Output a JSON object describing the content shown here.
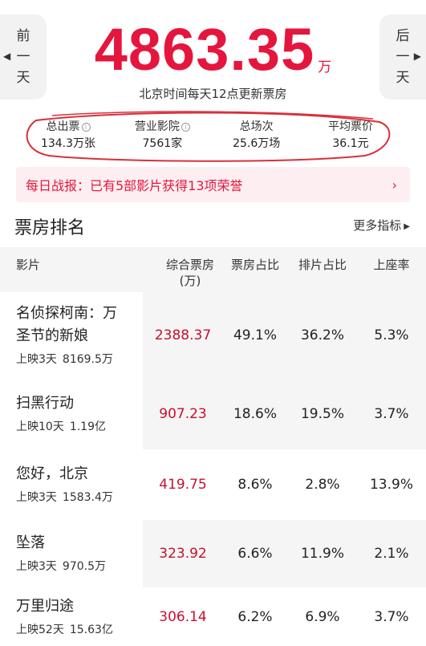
{
  "header": {
    "prev_day": [
      "前",
      "一",
      "天"
    ],
    "next_day": [
      "后",
      "一",
      "天"
    ],
    "total_box_office": "4863.35",
    "total_unit": "万",
    "update_note": "北京时间每天12点更新票房"
  },
  "stats": [
    {
      "label": "总出票",
      "value": "134.3万张",
      "has_info": true
    },
    {
      "label": "营业影院",
      "value": "7561家",
      "has_info": true
    },
    {
      "label": "总场次",
      "value": "25.6万场",
      "has_info": false
    },
    {
      "label": "平均票价",
      "value": "36.1元",
      "has_info": false
    }
  ],
  "banner": {
    "text": "每日战报：已有5部影片获得13项荣誉",
    "chevron": "›"
  },
  "ranking": {
    "title": "票房排名",
    "more": "更多指标",
    "columns": {
      "film": "影片",
      "gross_line1": "综合票房",
      "gross_line2": "(万)",
      "share": "票房占比",
      "schedule": "排片占比",
      "occupancy": "上座率"
    },
    "rows": [
      {
        "name_line1": "名侦探柯南：万",
        "name_line2": "圣节的新娘",
        "days": "上映3天",
        "cumulative": "8169.5万",
        "gross": "2388.37",
        "share": "49.1%",
        "schedule": "36.2%",
        "occupancy": "5.3%"
      },
      {
        "name_line1": "扫黑行动",
        "name_line2": "",
        "days": "上映10天",
        "cumulative": "1.19亿",
        "gross": "907.23",
        "share": "18.6%",
        "schedule": "19.5%",
        "occupancy": "3.7%"
      },
      {
        "name_line1": "您好，北京",
        "name_line2": "",
        "days": "上映3天",
        "cumulative": "1583.4万",
        "gross": "419.75",
        "share": "8.6%",
        "schedule": "2.8%",
        "occupancy": "13.9%"
      },
      {
        "name_line1": "坠落",
        "name_line2": "",
        "days": "上映3天",
        "cumulative": "970.5万",
        "gross": "323.92",
        "share": "6.6%",
        "schedule": "11.9%",
        "occupancy": "2.1%"
      },
      {
        "name_line1": "万里归途",
        "name_line2": "",
        "days": "上映52天",
        "cumulative": "15.63亿",
        "gross": "306.14",
        "share": "6.2%",
        "schedule": "6.9%",
        "occupancy": "3.7%"
      }
    ]
  },
  "colors": {
    "accent": "#e5163e",
    "gross": "#c8102e",
    "banner_bg": "#fdeff1",
    "annotation": "#d9303a"
  }
}
